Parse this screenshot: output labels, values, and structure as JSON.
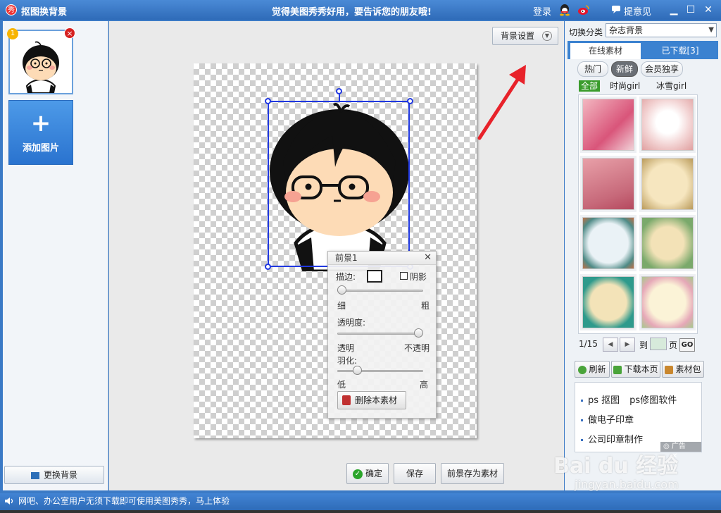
{
  "titlebar": {
    "app_icon_text": "秀",
    "app_title": "抠图换背景",
    "slogan": "觉得美图秀秀好用，要告诉您的朋友哦!",
    "login": "登录",
    "feedback": "提意见"
  },
  "left": {
    "thumb_badge": "1",
    "add_image": "添加图片",
    "change_bg": "更换背景"
  },
  "center": {
    "bg_settings": "背景设置",
    "fg_panel": {
      "title": "前景1",
      "stroke_label": "描边:",
      "shadow_label": "阴影",
      "thin": "细",
      "thick": "粗",
      "opacity_label": "透明度:",
      "transparent": "透明",
      "opaque": "不透明",
      "feather_label": "羽化:",
      "low": "低",
      "high": "高",
      "delete_label": "删除本素材",
      "stroke_level": 0.0,
      "opacity_level": 1.0,
      "feather_level": 0.2
    },
    "ok_label": "确定",
    "save_label": "保存",
    "save_fg_label": "前景存为素材"
  },
  "right": {
    "category_label": "切换分类",
    "category_value": "杂志背景",
    "tab_online": "在线素材",
    "tab_downloaded": "已下载[3]",
    "subtabs": [
      "热门",
      "新鲜",
      "会员独享"
    ],
    "filters": [
      "全部",
      "时尚girl",
      "冰雪girl"
    ],
    "page_text": "1/15",
    "to_label": "到",
    "page_label": "页",
    "go_label": "GO",
    "refresh": "刷新",
    "download_page": "下载本页",
    "material_pack": "素材包",
    "ads": [
      "ps 抠图",
      "ps修图软件",
      "做电子印章",
      "公司印章制作"
    ],
    "ad_tag": "广告"
  },
  "statusbar": {
    "text": "网吧、办公室用户无须下载即可使用美图秀秀，马上体验"
  },
  "watermark": {
    "brand": "Bai du 经验",
    "url": "jingyan.baidu.com"
  },
  "colors": {
    "titlebar": "#3b7ac6",
    "selection": "#2038e0",
    "arrow": "#e8222a",
    "tab_active_bg": "#3b82d0",
    "filter_selected": "#3a9c2c"
  }
}
